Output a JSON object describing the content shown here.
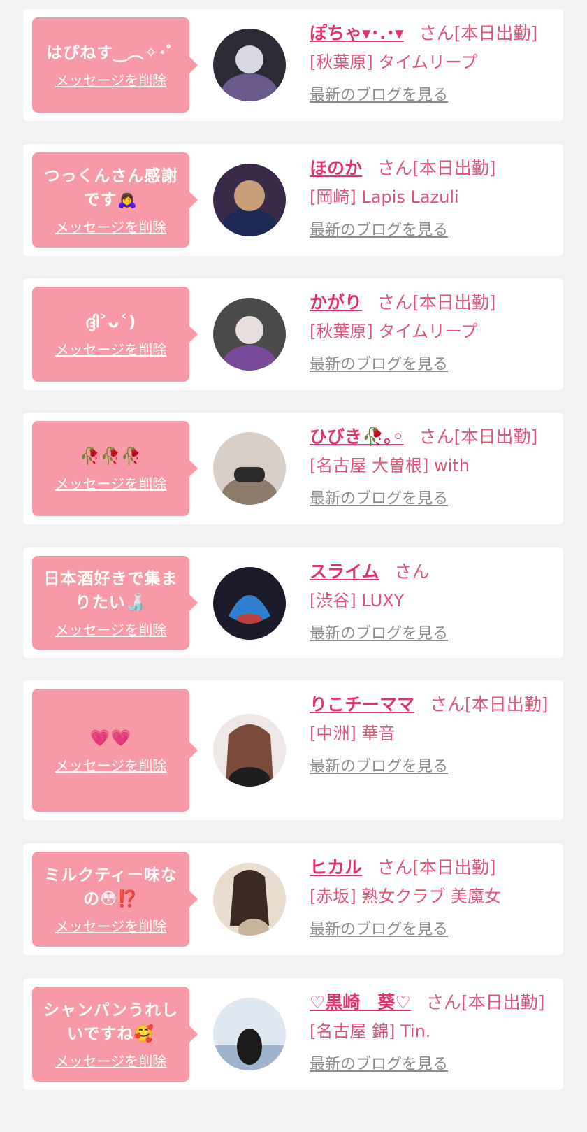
{
  "cards": [
    {
      "message": "はぴねす‿︵✧･ﾟ",
      "delete_label": "メッセージを削除",
      "name": "ぽちゃ▾･.･▾",
      "suffix": "さん[本日出勤]",
      "shop": "[秋葉原] タイムリープ",
      "blog_label": "最新のブログを見る",
      "avatar_colors": [
        "#2b2b36",
        "#6a5a8c",
        "#d9d9e3"
      ]
    },
    {
      "message": "つっくんさん感謝です🙇‍♀️",
      "delete_label": "メッセージを削除",
      "name": "ほのか",
      "suffix": "さん[本日出勤]",
      "shop": "[岡崎] Lapis Lazuli",
      "blog_label": "最新のブログを見る",
      "avatar_colors": [
        "#3a2a4a",
        "#c7a07a",
        "#1d2a55"
      ]
    },
    {
      "message": "ദ്ദി˃ᴗ˂)",
      "delete_label": "メッセージを削除",
      "name": "かがり",
      "suffix": "さん[本日出勤]",
      "shop": "[秋葉原] タイムリープ",
      "blog_label": "最新のブログを見る",
      "avatar_colors": [
        "#4a4a4a",
        "#e9dede",
        "#7a4a9a"
      ]
    },
    {
      "message": "🥀🥀🥀",
      "delete_label": "メッセージを削除",
      "name": "ひびき🥀｡◦",
      "suffix": "さん[本日出勤]",
      "shop": "[名古屋 大曽根] with",
      "blog_label": "最新のブログを見る",
      "avatar_colors": [
        "#d8cfc8",
        "#2b2b2b",
        "#8c7a6a"
      ]
    },
    {
      "message": "日本酒好きで集まりたい🍶",
      "delete_label": "メッセージを削除",
      "name": "スライム",
      "suffix": "さん",
      "shop": "[渋谷] LUXY",
      "blog_label": "最新のブログを見る",
      "avatar_colors": [
        "#1a1a2a",
        "#2f7fd0",
        "#c04040"
      ]
    },
    {
      "message": "💗💗",
      "delete_label": "メッセージを削除",
      "name": "りこチーママ",
      "suffix": "さん[本日出勤]",
      "shop": "[中洲] 華音",
      "blog_label": "最新のブログを見る",
      "avatar_colors": [
        "#efe6e6",
        "#7a4a3a",
        "#1e1e1e"
      ]
    },
    {
      "message": "ミルクティー味なの😳⁉️",
      "delete_label": "メッセージを削除",
      "name": "ヒカル",
      "suffix": "さん[本日出勤]",
      "shop": "[赤坂] 熟女クラブ 美魔女",
      "blog_label": "最新のブログを見る",
      "avatar_colors": [
        "#e8ddcf",
        "#3a2a22",
        "#c9b59d"
      ]
    },
    {
      "message": "シャンパンうれしいですね🥰",
      "delete_label": "メッセージを削除",
      "name": "♡黒崎　葵♡",
      "suffix": "さん[本日出勤]",
      "shop": "[名古屋 錦] Tin.",
      "blog_label": "最新のブログを見る",
      "avatar_colors": [
        "#dfe7f1",
        "#1a1a1a",
        "#9fb4cc"
      ]
    }
  ]
}
